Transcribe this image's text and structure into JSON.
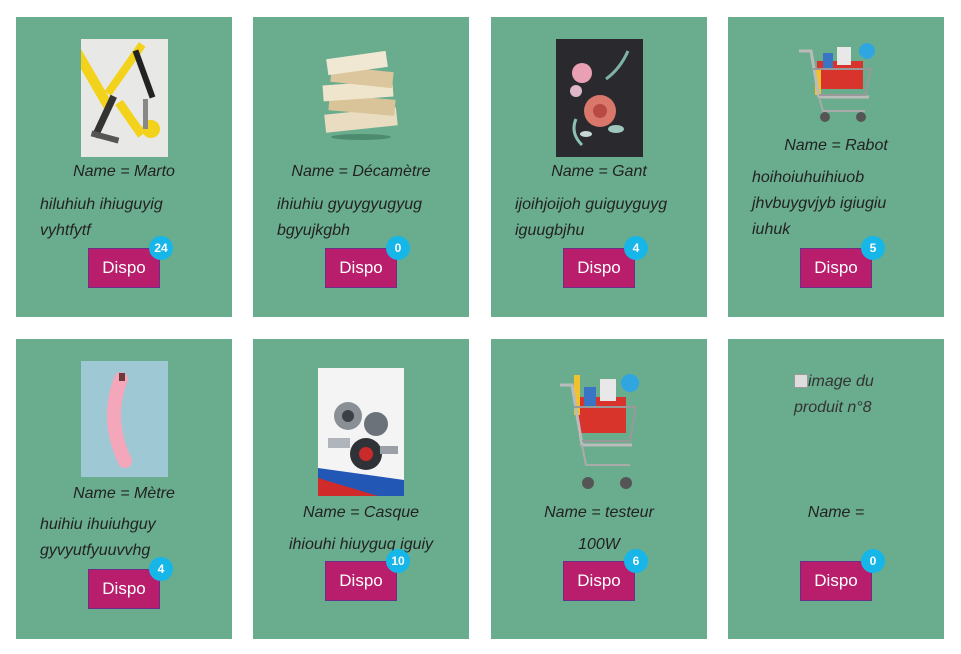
{
  "products": [
    {
      "name": "Name = Marto",
      "description": "hiluhiuh ihiuguyig vyhtfytf",
      "button": "Dispo",
      "count": "24",
      "image": "tools-photo"
    },
    {
      "name": "Name = Décamètre",
      "description": "ihiuhiu gyuygyugyug bgyujkgbh",
      "button": "Dispo",
      "count": "0",
      "image": "paper-stack-photo"
    },
    {
      "name": "Name = Gant",
      "description": "ijoihjoijoh guiguyguyg iguugbjhu",
      "button": "Dispo",
      "count": "4",
      "image": "flower-embroidery-photo"
    },
    {
      "name": "Name = Rabot",
      "description": "hoihoiuhuihiuob jhvbuygvjyb igiugiu iuhuk",
      "button": "Dispo",
      "count": "5",
      "image": "shopping-cart-photo"
    },
    {
      "name": "Name = Mètre",
      "description": "huihiu ihuiuhguy gyvyutfyuuvvhg",
      "button": "Dispo",
      "count": "4",
      "image": "pink-banana-photo"
    },
    {
      "name": "Name = Casque",
      "description": "ihiouhi hiuyguq iguiy",
      "button": "Dispo",
      "count": "10",
      "image": "auto-parts-photo"
    },
    {
      "name": "Name = testeur",
      "description": "100W",
      "button": "Dispo",
      "count": "6",
      "image": "shopping-cart-photo"
    },
    {
      "name": "Name =",
      "description": "",
      "button": "Dispo",
      "count": "0",
      "image_alt": "image du produit n°8"
    }
  ]
}
